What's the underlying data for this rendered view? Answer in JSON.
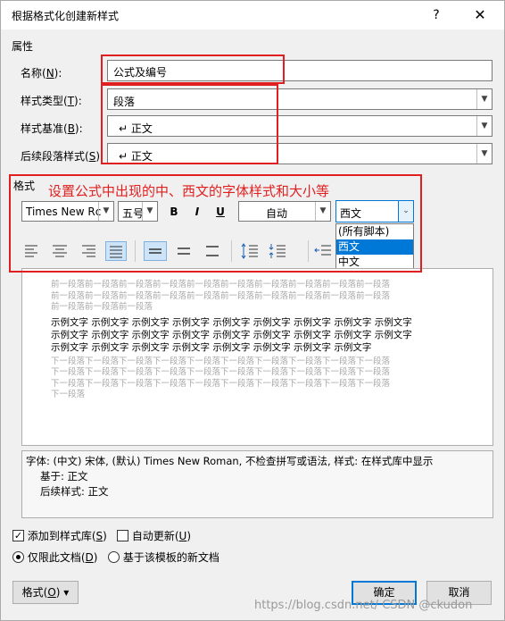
{
  "window": {
    "title": "根据格式化创建新样式",
    "help": "?",
    "close": "✕"
  },
  "properties": {
    "section": "属性",
    "name_label": "名称(",
    "name_key": "N",
    "name_suffix": "):",
    "name_value": "公式及编号",
    "type_label": "样式类型(",
    "type_key": "T",
    "type_suffix": "):",
    "type_value": "段落",
    "base_label": "样式基准(",
    "base_key": "B",
    "base_suffix": "):",
    "base_value": "↵ 正文",
    "follow_label": "后续段落样式(",
    "follow_key": "S",
    "follow_suffix": "):",
    "follow_value": "↵ 正文"
  },
  "format": {
    "section": "格式",
    "annotation": "设置公式中出现的中、西文的字体样式和大小等",
    "font_value": "Times New Rc",
    "size_value": "五号",
    "bold": "B",
    "italic": "I",
    "underline": "U",
    "color_value": "自动",
    "script_value": "西文",
    "script_options": [
      "(所有脚本)",
      "西文",
      "中文"
    ],
    "script_selected_index": 1
  },
  "preview": {
    "prev_lines": [
      "前一段落前一段落前一段落前一段落前一段落前一段落前一段落前一段落前一段落前一段落",
      "前一段落前一段落前一段落前一段落前一段落前一段落前一段落前一段落前一段落前一段落",
      "前一段落前一段落前一段落"
    ],
    "sample_lines": [
      "示例文字 示例文字 示例文字 示例文字 示例文字 示例文字 示例文字 示例文字 示例文字",
      "示例文字 示例文字 示例文字 示例文字 示例文字 示例文字 示例文字 示例文字 示例文字",
      "示例文字 示例文字 示例文字 示例文字 示例文字 示例文字 示例文字 示例文字"
    ],
    "next_lines": [
      "下一段落下一段落下一段落下一段落下一段落下一段落下一段落下一段落下一段落下一段落",
      "下一段落下一段落下一段落下一段落下一段落下一段落下一段落下一段落下一段落下一段落",
      "下一段落下一段落下一段落下一段落下一段落下一段落下一段落下一段落下一段落下一段落",
      "下一段落"
    ]
  },
  "description": {
    "line1": "字体: (中文) 宋体, (默认) Times New Roman, 不检查拼写或语法, 样式: 在样式库中显示",
    "line2": "基于: 正文",
    "line3": "后续样式: 正文"
  },
  "options": {
    "add_to_gallery": "添加到样式库(",
    "add_to_gallery_key": "S",
    "add_to_gallery_suffix": ")",
    "add_to_gallery_checked": true,
    "auto_update": "自动更新(",
    "auto_update_key": "U",
    "auto_update_suffix": ")",
    "auto_update_checked": false,
    "only_this_doc": "仅限此文档(",
    "only_this_doc_key": "D",
    "only_this_doc_suffix": ")",
    "only_this_doc_selected": true,
    "new_docs": "基于该模板的新文档"
  },
  "footer": {
    "format_button": "格式(",
    "format_key": "O",
    "format_suffix": ") ▾",
    "ok": "确定",
    "cancel": "取消",
    "watermark": "https://blog.csdn.net/ CSDN @ckudon"
  },
  "colors": {
    "annotation_red": "#e02020",
    "highlight_blue": "#0078d7"
  }
}
